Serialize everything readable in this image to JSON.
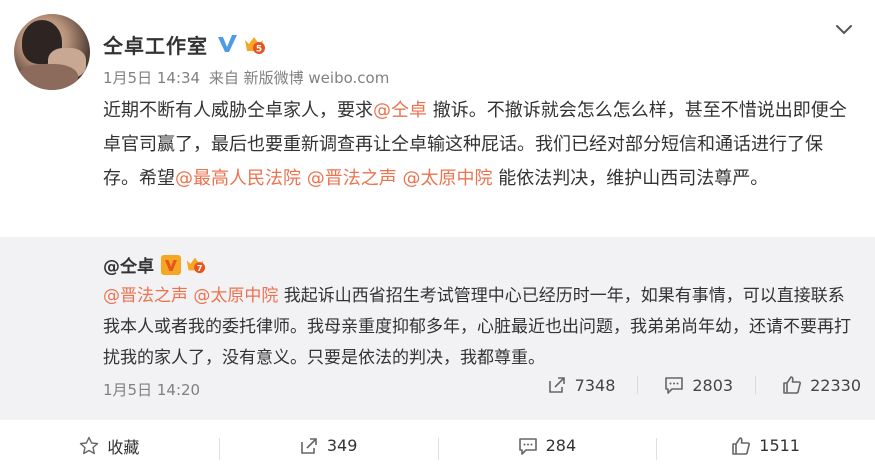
{
  "post": {
    "author": "仝卓工作室",
    "date": "1月5日 14:34",
    "source": "来自 新版微博 weibo.com",
    "content": [
      {
        "text": "近期不断有人威胁仝卓家人，要求",
        "mention": false
      },
      {
        "text": "@仝卓",
        "mention": true
      },
      {
        "text": " 撤诉。不撤诉就会怎么怎么样，甚至不惜说出即便仝卓官司赢了，最后也要重新调查再让仝卓输这种屁话。我们已经对部分短信和通话进行了保存。希望",
        "mention": false
      },
      {
        "text": "@最高人民法院",
        "mention": true
      },
      {
        "text": " ",
        "mention": false
      },
      {
        "text": "@晋法之声",
        "mention": true
      },
      {
        "text": " ",
        "mention": false
      },
      {
        "text": "@太原中院",
        "mention": true
      },
      {
        "text": " 能依法判决，维护山西司法尊严。",
        "mention": false
      }
    ]
  },
  "repost": {
    "author": "@仝卓",
    "content": [
      {
        "text": "@晋法之声",
        "mention": true
      },
      {
        "text": " ",
        "mention": false
      },
      {
        "text": "@太原中院",
        "mention": true
      },
      {
        "text": " 我起诉山西省招生考试管理中心已经历时一年，如果有事情，可以直接联系我本人或者我的委托律师。我母亲重度抑郁多年，心脏最近也出问题，我弟弟尚年幼，还请不要再打扰我的家人了，没有意义。只要是依法的判决，我都尊重。",
        "mention": false
      }
    ],
    "date": "1月5日 14:20",
    "forward_count": "7348",
    "comment_count": "2803",
    "like_count": "22330"
  },
  "actions": {
    "favorite_label": "收藏",
    "forward_count": "349",
    "comment_count": "284",
    "like_count": "1511"
  },
  "colors": {
    "mention": "#eb7350",
    "verified": "#4d9de6",
    "level_badge": "#f5a623",
    "repost_bg": "#f2f2f5"
  },
  "icons": {
    "verified": "verified-v-icon",
    "level": "level-crown-icon",
    "more": "chevron-down-icon",
    "favorite": "star-icon",
    "forward": "forward-icon",
    "comment": "comment-icon",
    "like": "thumbs-up-icon"
  }
}
